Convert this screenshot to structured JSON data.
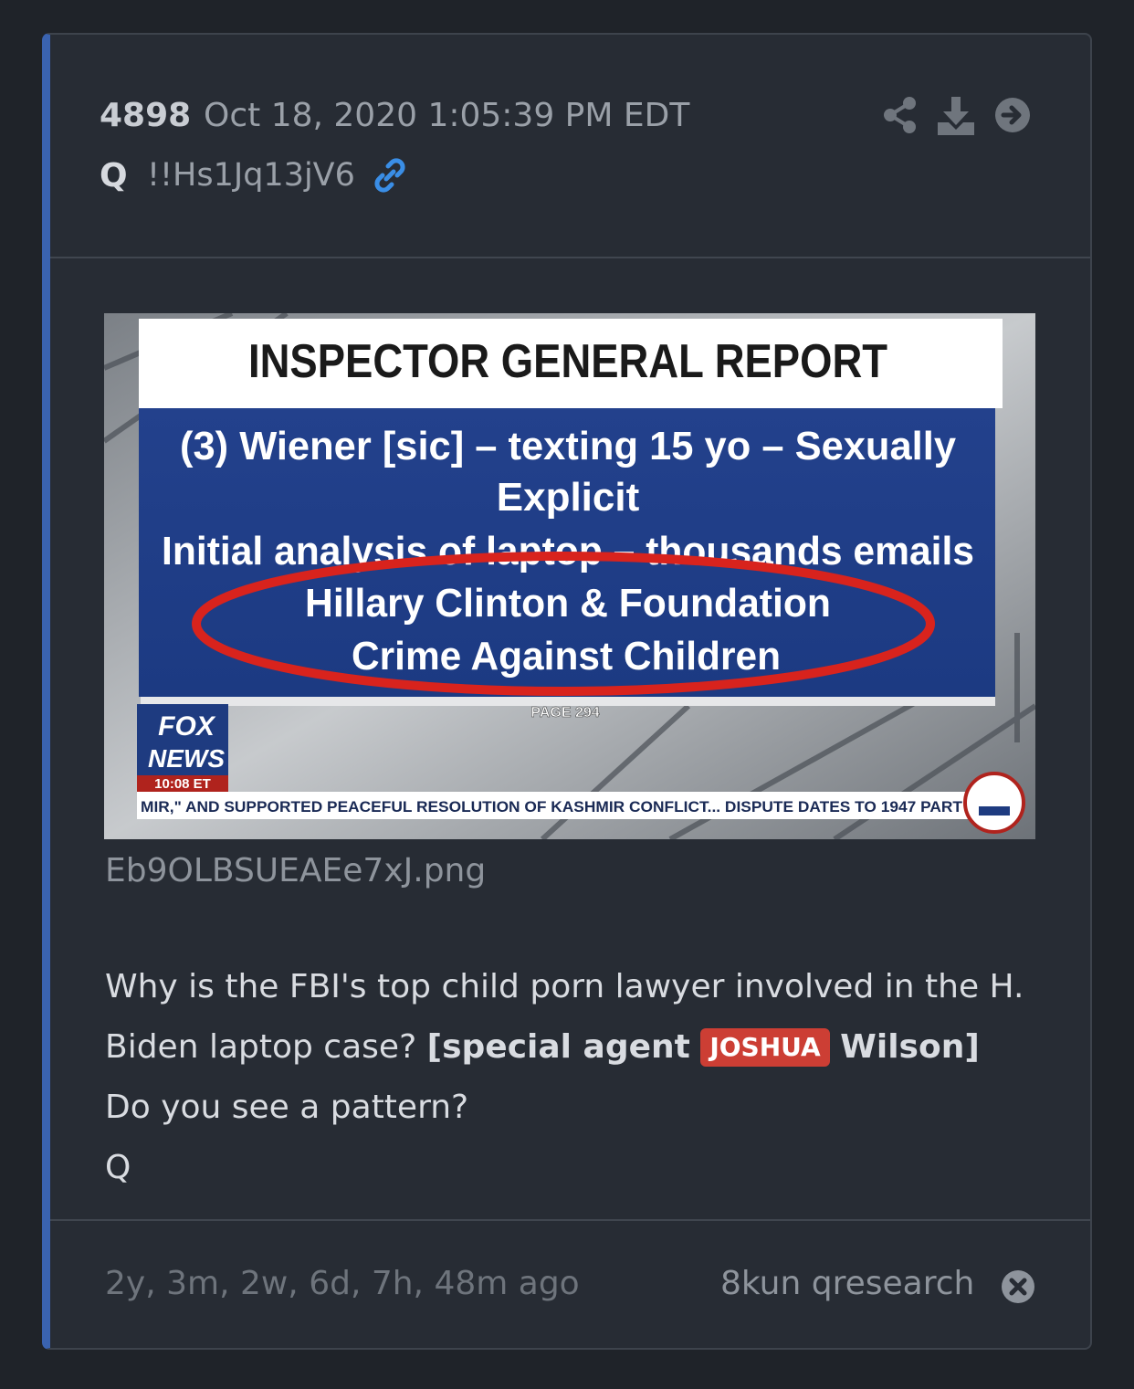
{
  "post": {
    "number": "4898",
    "date": "Oct 18, 2020 1:05:39 PM EDT",
    "author": "Q",
    "tripcode": "!!Hs1Jq13jV6"
  },
  "header_icons": [
    "share-icon",
    "download-icon",
    "arrow-right-circle-icon"
  ],
  "image": {
    "filename": "Eb9OLBSUEAEe7xJ.png",
    "headline": "INSPECTOR GENERAL REPORT",
    "line1": "(3) Wiener [sic] – texting 15 yo – Sexually",
    "line2": "Explicit",
    "line3": "Initial analysis of laptop – thousands emails",
    "line4": "Hillary Clinton & Foundation",
    "line5": "Crime Against Children",
    "page": "PAGE 294",
    "network_top": "FOX",
    "network_bottom": "NEWS",
    "time": "10:08 ET",
    "ticker": "MIR,\" AND SUPPORTED PEACEFUL RESOLUTION OF KASHMIR CONFLICT... DISPUTE DATES TO 1947 PART",
    "highlight_color": "#d8231d"
  },
  "message": {
    "text1": "Why is the FBI's top child porn lawyer involved in the H. Biden laptop case?",
    "bold_start": "[special agent",
    "tag": "JOSHUA",
    "bold_end": "Wilson]",
    "line2": "Do you see a pattern?",
    "line3": "Q"
  },
  "footer": {
    "age": "2y, 3m, 2w, 6d, 7h, 48m ago",
    "source": "8kun qresearch"
  },
  "colors": {
    "accent": "#3a63b0",
    "tag": "#cc3e34",
    "link": "#3a8ee6"
  }
}
